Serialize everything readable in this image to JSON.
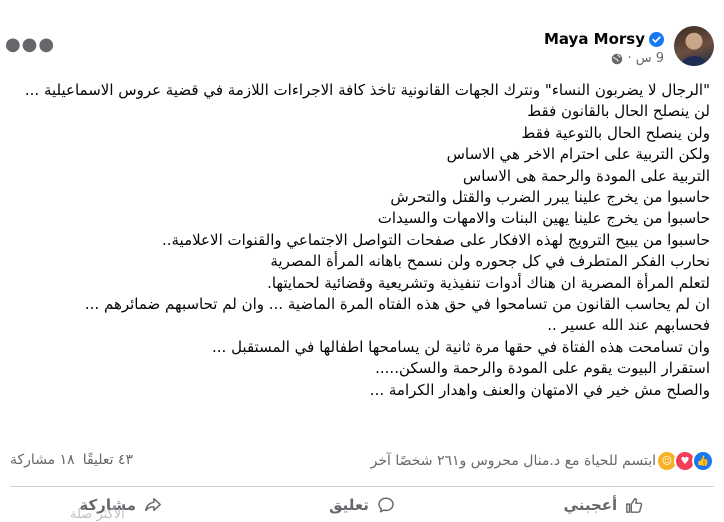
{
  "author": {
    "name": "Maya Morsy",
    "time": "9 س ·"
  },
  "post_lines": [
    "\"الرجال لا يضربون النساء\" ونترك الجهات القانونية تاخذ كافة الاجراءات اللازمة في قضية عروس الاسماعيلية ...",
    "لن ينصلح الحال بالقانون فقط",
    "ولن ينصلح الحال بالتوعية فقط",
    "ولكن التربية على احترام الاخر هي الاساس",
    "التربية على المودة والرحمة هى الاساس",
    "حاسبوا من يخرج علينا يبرر الضرب والقتل والتحرش",
    "حاسبوا من يخرج علينا يهين البنات والامهات والسيدات",
    "حاسبوا من يبيح الترويج لهذه الافكار على صفحات التواصل الاجتماعي والقنوات الاعلامية..",
    "نحارب الفكر المتطرف في كل جحوره ولن نسمح باهانه المرأة المصرية",
    "لتعلم المرأة المصرية ان هناك أدوات تنفيذية وتشريعية وقضائية لحمايتها.",
    "ان لم يحاسب القانون من تسامحوا في حق هذه الفتاه المرة الماضية ... وان لم تحاسبهم ضمائرهم ...",
    "فحسابهم عند الله عسير ..",
    "وان تسامحت هذه الفتاة في حقها مرة ثانية لن  يسامحها اطفالها في المستقبل ...",
    "استقرار البيوت يقوم على المودة والرحمة والسكن.....",
    "والصلح مش خير في الامتهان والعنف واهدار الكرامة ..."
  ],
  "reactions": {
    "summary": "ابتسم للحياة مع د.منال محروس و٢٦١ شخصًا آخر",
    "icons": [
      "like-icon",
      "love-icon",
      "care-icon"
    ]
  },
  "counts": {
    "comments": "٤٣ تعليقًا",
    "shares": "١٨ مشاركة"
  },
  "actions": {
    "like": "أعجبني",
    "comment": "تعليق",
    "share": "مشاركة"
  },
  "faded_text": "الأكثر صلة",
  "colors": {
    "accent": "#1877f2",
    "secondary_text": "#65676b",
    "love": "#f33e58",
    "care": "#f7b125"
  }
}
